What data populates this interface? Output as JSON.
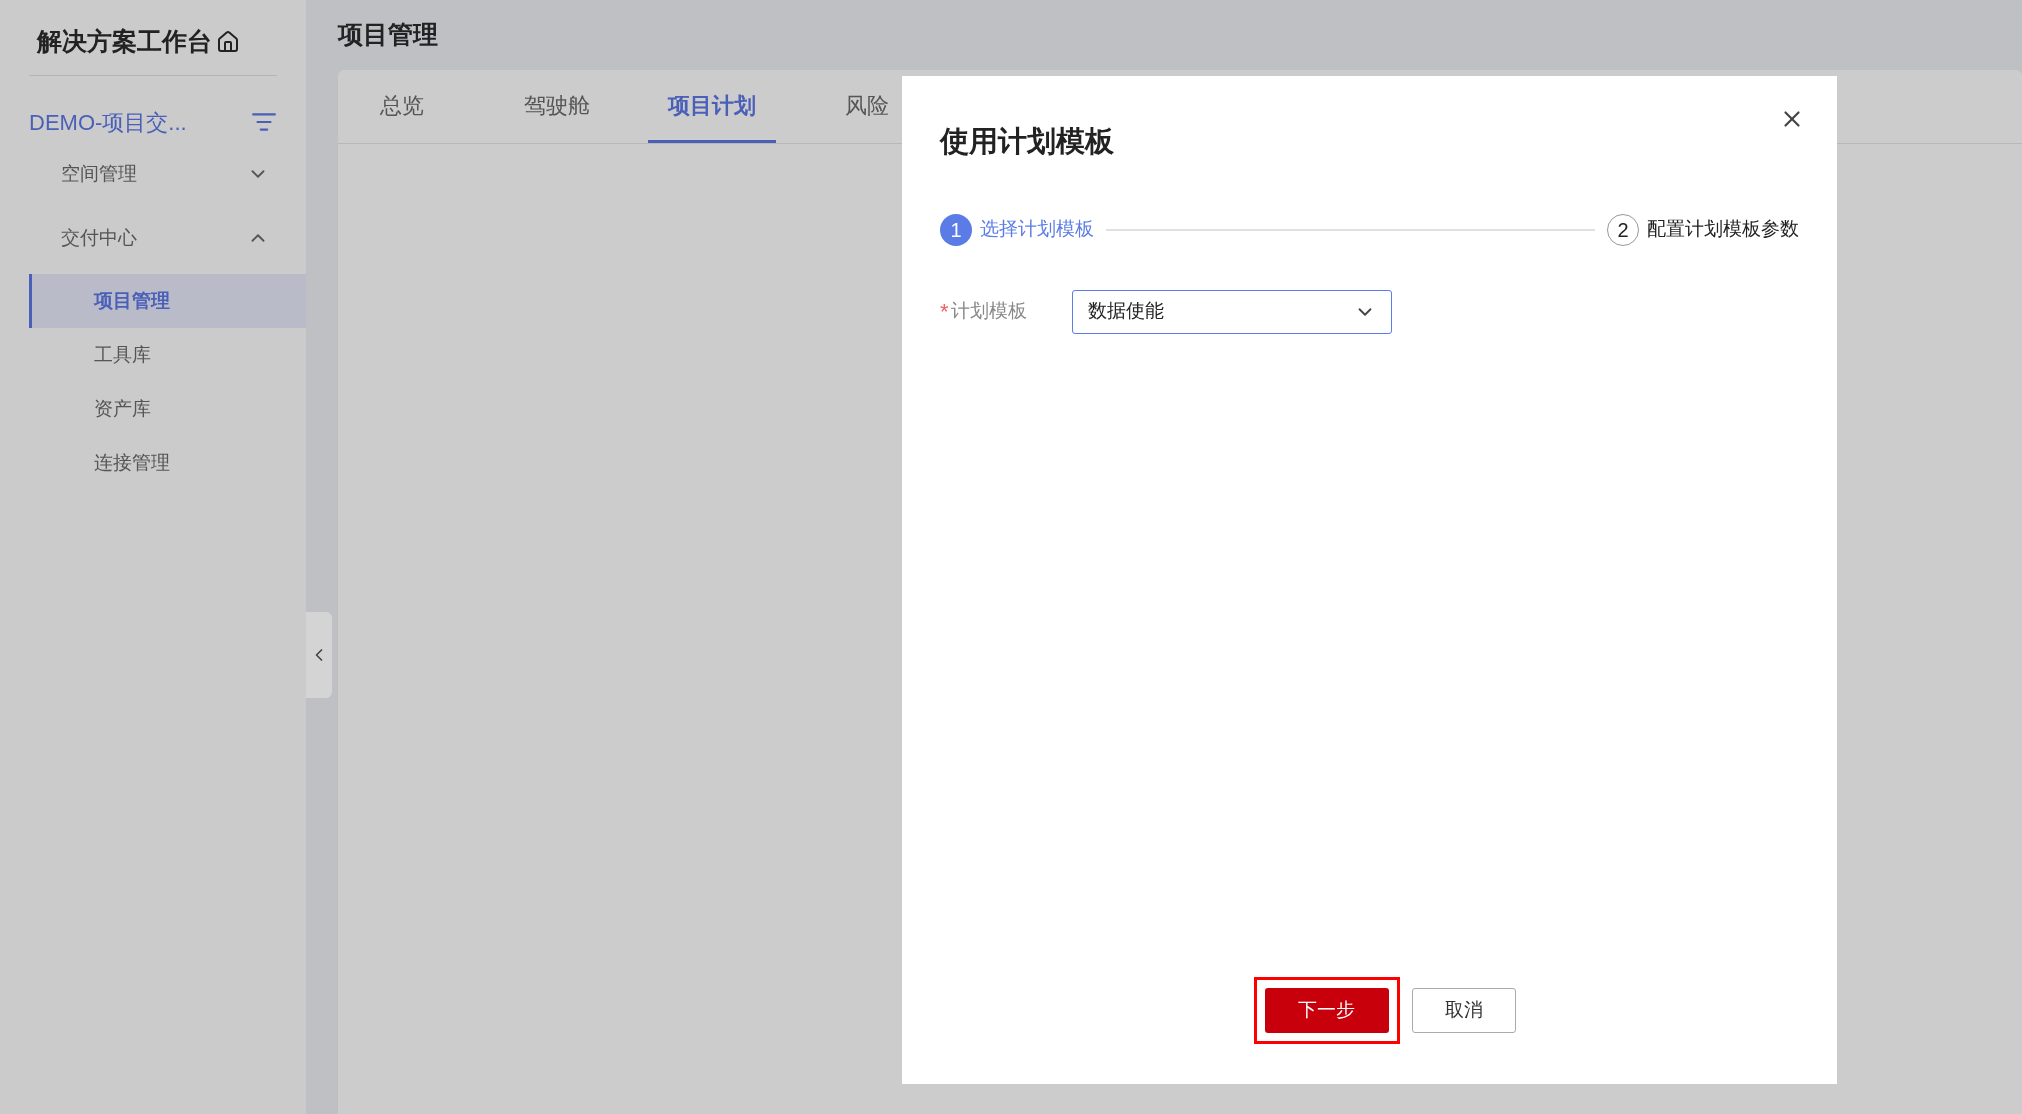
{
  "sidebar": {
    "title": "解决方案工作台",
    "project": "DEMO-项目交...",
    "groups": [
      {
        "label": "空间管理",
        "expanded": false
      },
      {
        "label": "交付中心",
        "expanded": true,
        "items": [
          {
            "label": "项目管理",
            "selected": true
          },
          {
            "label": "工具库",
            "selected": false
          },
          {
            "label": "资产库",
            "selected": false
          },
          {
            "label": "连接管理",
            "selected": false
          }
        ]
      }
    ]
  },
  "page": {
    "title": "项目管理",
    "tabs": [
      {
        "label": "总览",
        "selected": false
      },
      {
        "label": "驾驶舱",
        "selected": false
      },
      {
        "label": "项目计划",
        "selected": true
      },
      {
        "label": "风险",
        "selected": false
      }
    ]
  },
  "dialog": {
    "title": "使用计划模板",
    "steps": [
      {
        "number": "1",
        "label": "选择计划模板",
        "active": true
      },
      {
        "number": "2",
        "label": "配置计划模板参数",
        "active": false
      }
    ],
    "field": {
      "label": "计划模板",
      "required_mark": "*",
      "value": "数据使能"
    },
    "buttons": [
      {
        "label": "下一步",
        "kind": "primary",
        "highlighted": true
      },
      {
        "label": "取消",
        "kind": "secondary",
        "highlighted": false
      }
    ]
  }
}
